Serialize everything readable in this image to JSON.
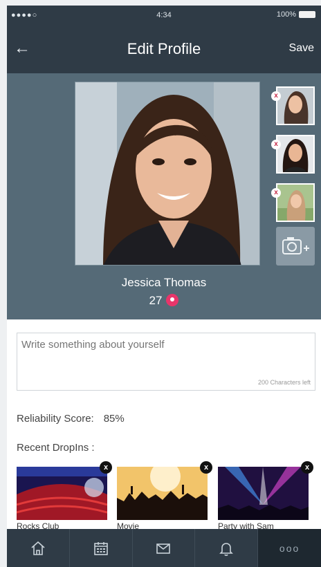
{
  "status_bar": {
    "signal": "●●●●○",
    "time": "4:34",
    "battery": "100%"
  },
  "nav": {
    "back_icon": "back-arrow-icon",
    "title": "Edit Profile",
    "save_label": "Save"
  },
  "profile": {
    "name": "Jessica Thomas",
    "age": "27",
    "thumbnails": [
      {
        "name": "thumbnail-1",
        "remove_label": "x"
      },
      {
        "name": "thumbnail-2",
        "remove_label": "x"
      },
      {
        "name": "thumbnail-3",
        "remove_label": "x"
      }
    ],
    "add_photo_icon": "camera-plus-icon",
    "location_icon": "location-pin-icon"
  },
  "about": {
    "placeholder": "Write something about yourself",
    "value": "",
    "chars_left": "200 Characters left"
  },
  "reliability": {
    "label": "Reliability Score:",
    "value": "85%"
  },
  "recent_dropins": {
    "label": "Recent DropIns :",
    "items": [
      {
        "caption": "Rocks Club",
        "remove_label": "x"
      },
      {
        "caption": "Movie",
        "remove_label": "x"
      },
      {
        "caption": "Party with Sam",
        "remove_label": "x"
      }
    ]
  },
  "tab_bar": {
    "tabs": [
      {
        "icon": "home-icon"
      },
      {
        "icon": "calendar-icon"
      },
      {
        "icon": "mail-icon"
      },
      {
        "icon": "bell-icon"
      },
      {
        "icon": "more-icon",
        "label": "ooo"
      }
    ]
  },
  "colors": {
    "bar": "#2f3b46",
    "header": "#556a77",
    "accent_pin": "#e8356a"
  }
}
